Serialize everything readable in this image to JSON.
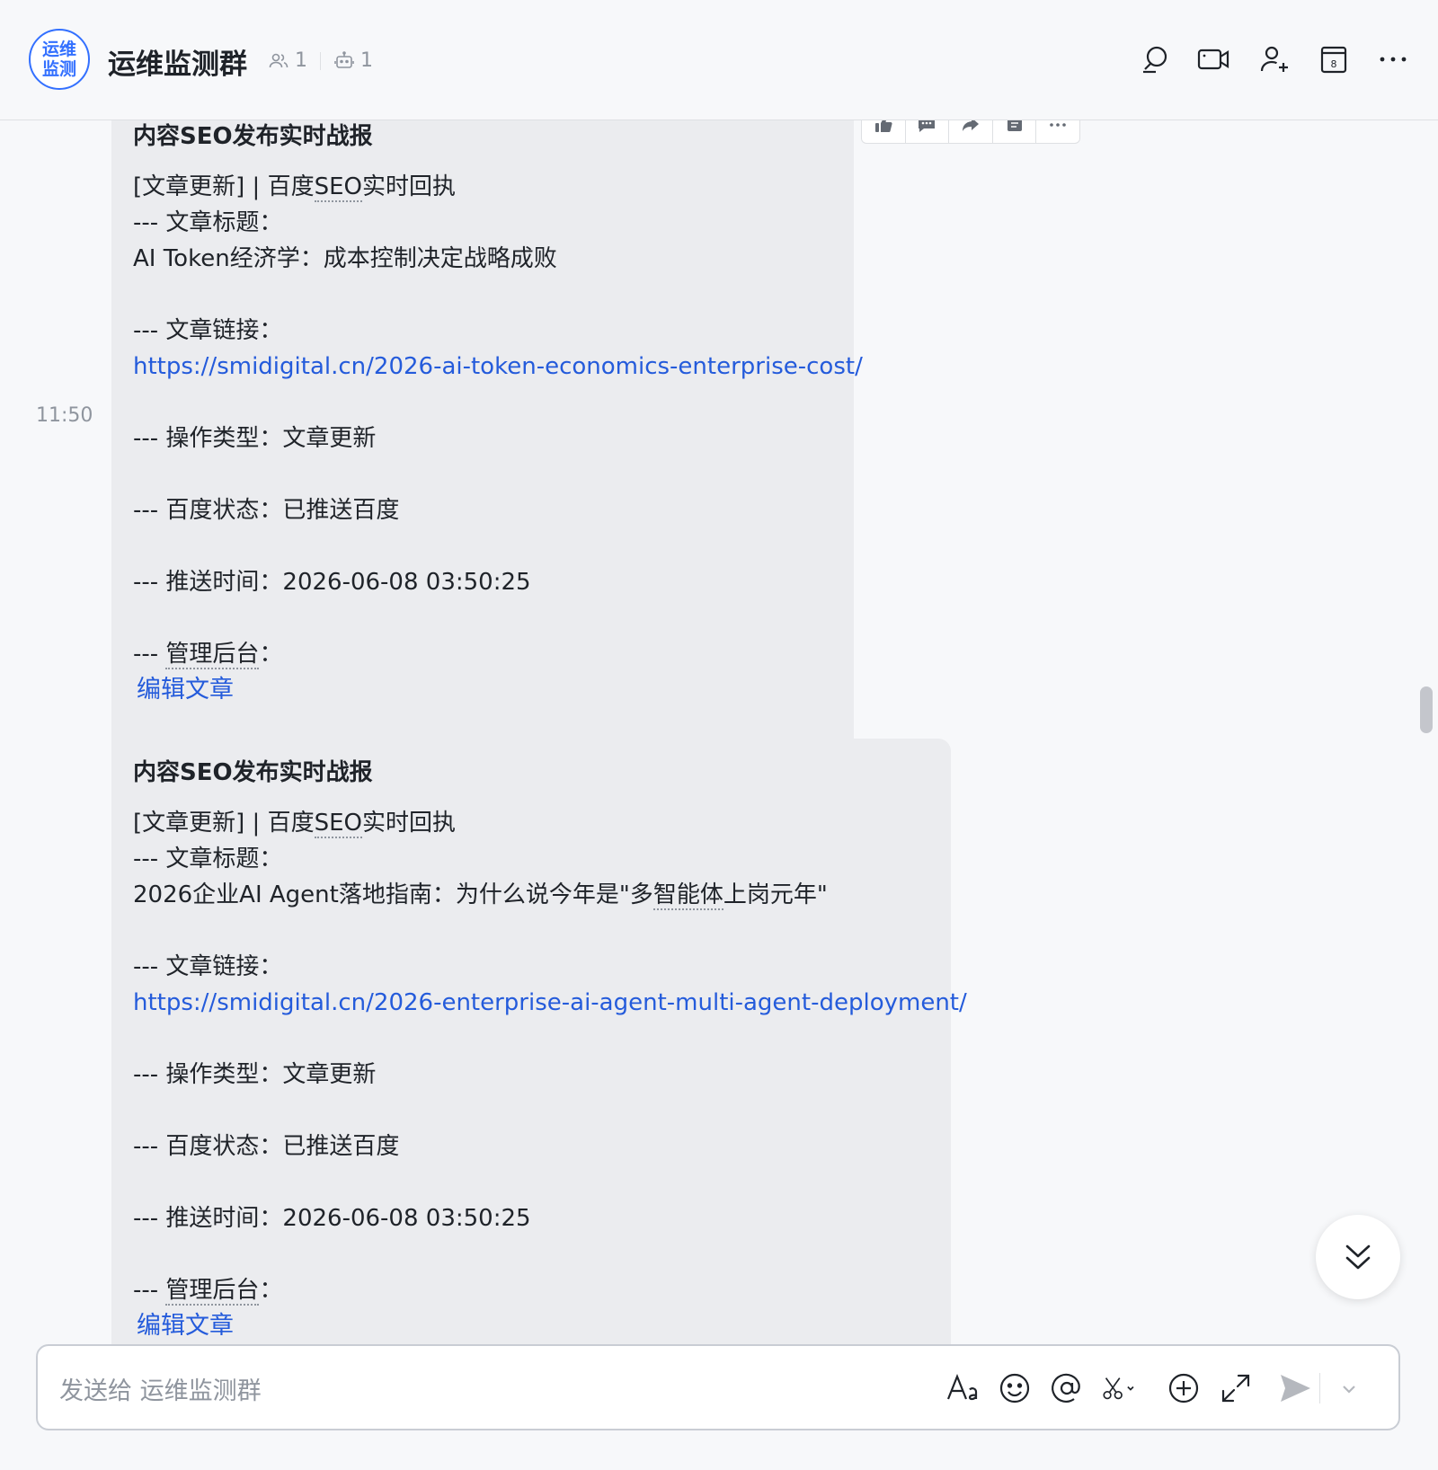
{
  "header": {
    "avatar_line1": "运维",
    "avatar_line2": "监测",
    "title": "运维监测群",
    "member_count": "1",
    "bot_count": "1",
    "calendar_day": "8",
    "icons": [
      "search-icon",
      "video-call-icon",
      "add-member-icon",
      "calendar-icon",
      "more-icon"
    ]
  },
  "messages": [
    {
      "time": "11:50",
      "title": "内容SEO发布实时战报",
      "line1_prefix": "[文章更新] | 百度",
      "line1_seo": "SEO",
      "line1_suffix": "实时回执",
      "title_label": "--- 文章标题：",
      "article_title": "AI Token经济学：成本控制决定战略成败",
      "link_label": "--- 文章链接：",
      "link": "https://smidigital.cn/2026-ai-token-economics-enterprise-cost/",
      "op_type": "--- 操作类型：文章更新",
      "baidu_status": "--- 百度状态：已推送百度",
      "push_time": "--- 推送时间：2026-06-08 03:50:25",
      "admin_prefix": "--- ",
      "admin_label": "管理后台",
      "admin_suffix": "：",
      "edit_link": "编辑文章"
    },
    {
      "title": "内容SEO发布实时战报",
      "line1_prefix": "[文章更新] | 百度",
      "line1_seo": "SEO",
      "line1_suffix": "实时回执",
      "title_label": "--- 文章标题：",
      "article_title_a": "2026企业AI Agent落地指南：为什么说今年是\"多",
      "article_title_b": "智能体",
      "article_title_c": "上岗元年\"",
      "link_label": "--- 文章链接：",
      "link": "https://smidigital.cn/2026-enterprise-ai-agent-multi-agent-deployment/",
      "op_type": "--- 操作类型：文章更新",
      "baidu_status": "--- 百度状态：已推送百度",
      "push_time": "--- 推送时间：2026-06-08 03:50:25",
      "admin_prefix": "--- ",
      "admin_label": "管理后台",
      "admin_suffix": "：",
      "edit_link": "编辑文章"
    }
  ],
  "message_actions": [
    "thumbs-up-icon",
    "reply-icon",
    "forward-icon",
    "pin-icon",
    "more-icon"
  ],
  "input": {
    "placeholder": "发送给 运维监测群",
    "tools": [
      "font-format-icon",
      "emoji-icon",
      "mention-icon",
      "screenshot-icon",
      "plus-icon",
      "expand-icon",
      "send-icon",
      "send-options-icon"
    ]
  },
  "colors": {
    "accent": "#3370ff",
    "link": "#245bdb",
    "bubble": "#ebecef",
    "background": "#f7f8fa"
  }
}
